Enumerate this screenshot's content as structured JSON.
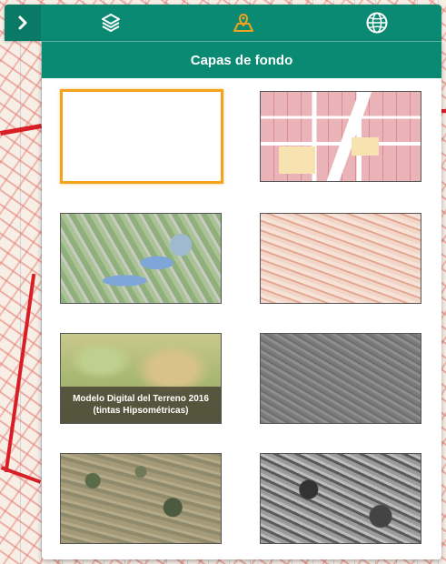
{
  "panel": {
    "title": "Capas de fondo"
  },
  "tabs": [
    {
      "icon": "layers-icon"
    },
    {
      "icon": "map-pin-icon",
      "active": true
    },
    {
      "icon": "globe-icon"
    }
  ],
  "colors": {
    "header": "#0b8a73",
    "active_tab_icon": "#f2a31b",
    "selected_border": "#f2a31b"
  },
  "basemaps": [
    {
      "id": "blank",
      "selected": true
    },
    {
      "id": "urban-cadastre"
    },
    {
      "id": "orthophoto-lakes"
    },
    {
      "id": "shaded-relief"
    },
    {
      "id": "mdt-hypsometric",
      "caption_line1": "Modelo Digital del Terreno 2016",
      "caption_line2": "(tintas Hipsométricas)"
    },
    {
      "id": "grayscale-relief"
    },
    {
      "id": "aerial-color"
    },
    {
      "id": "aerial-bw"
    }
  ]
}
